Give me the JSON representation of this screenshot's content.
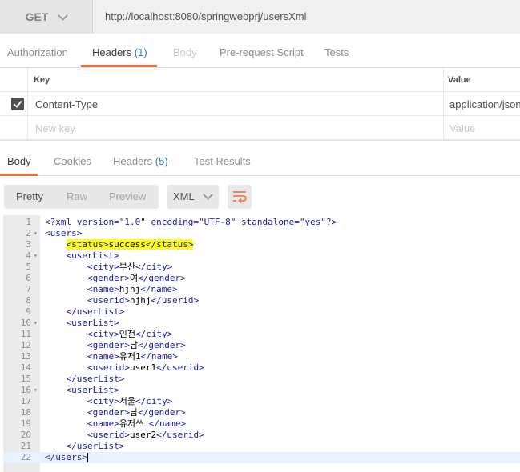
{
  "request": {
    "method": "GET",
    "url": "http://localhost:8080/springwebprj/usersXml"
  },
  "request_tabs": {
    "authorization": "Authorization",
    "headers": "Headers",
    "headers_count": "(1)",
    "body": "Body",
    "pre_request": "Pre-request Script",
    "tests": "Tests"
  },
  "headers_table": {
    "col_key": "Key",
    "col_value": "Value",
    "row_key": "Content-Type",
    "row_value": "application/json",
    "new_key_placeholder": "New key",
    "value_placeholder": "Value"
  },
  "response_tabs": {
    "body": "Body",
    "cookies": "Cookies",
    "headers": "Headers",
    "headers_count": "(5)",
    "test_results": "Test Results"
  },
  "toolbar": {
    "pretty": "Pretty",
    "raw": "Raw",
    "preview": "Preview",
    "format": "XML"
  },
  "code": {
    "lines": [
      "<?xml version=\"1.0\" encoding=\"UTF-8\" standalone=\"yes\"?>",
      "<users>",
      "    <status>success</status>",
      "    <userList>",
      "        <city>부산</city>",
      "        <gender>여</gender>",
      "        <name>hjhj</name>",
      "        <userid>hjhj</userid>",
      "    </userList>",
      "    <userList>",
      "        <city>인천</city>",
      "        <gender>남</gender>",
      "        <name>유저1</name>",
      "        <userid>user1</userid>",
      "    </userList>",
      "    <userList>",
      "        <city>서울</city>",
      "        <gender>남</gender>",
      "        <name>유저쓰 </name>",
      "        <userid>user2</userid>",
      "    </userList>",
      "</users>"
    ],
    "fold_lines": [
      2,
      4,
      10,
      16
    ],
    "highlighted_line": 3,
    "current_line": 22
  },
  "colors": {
    "accent_underline": "#f26b3a",
    "count_blue": "#2c7bd0",
    "xml_tag": "#1a1aa6",
    "highlight": "#ffff1a"
  }
}
